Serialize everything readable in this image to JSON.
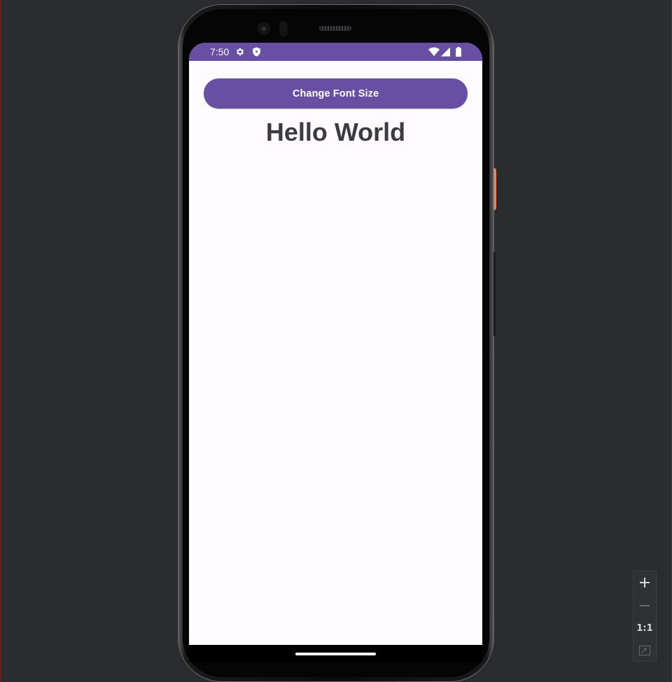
{
  "status_bar": {
    "time": "7:50",
    "icons": [
      "settings-icon",
      "shield-play-icon",
      "wifi-icon",
      "cell-signal-icon",
      "battery-icon"
    ],
    "background_color": "#6750a4"
  },
  "app": {
    "button_label": "Change Font Size",
    "greeting": "Hello World",
    "accent_color": "#6750a4",
    "background_color": "#fffbfe"
  },
  "zoom_controls": {
    "zoom_in_icon": "plus-icon",
    "zoom_out_icon": "minus-icon",
    "actual_size_label": "1:1",
    "fit_icon": "fit-screen-icon"
  }
}
